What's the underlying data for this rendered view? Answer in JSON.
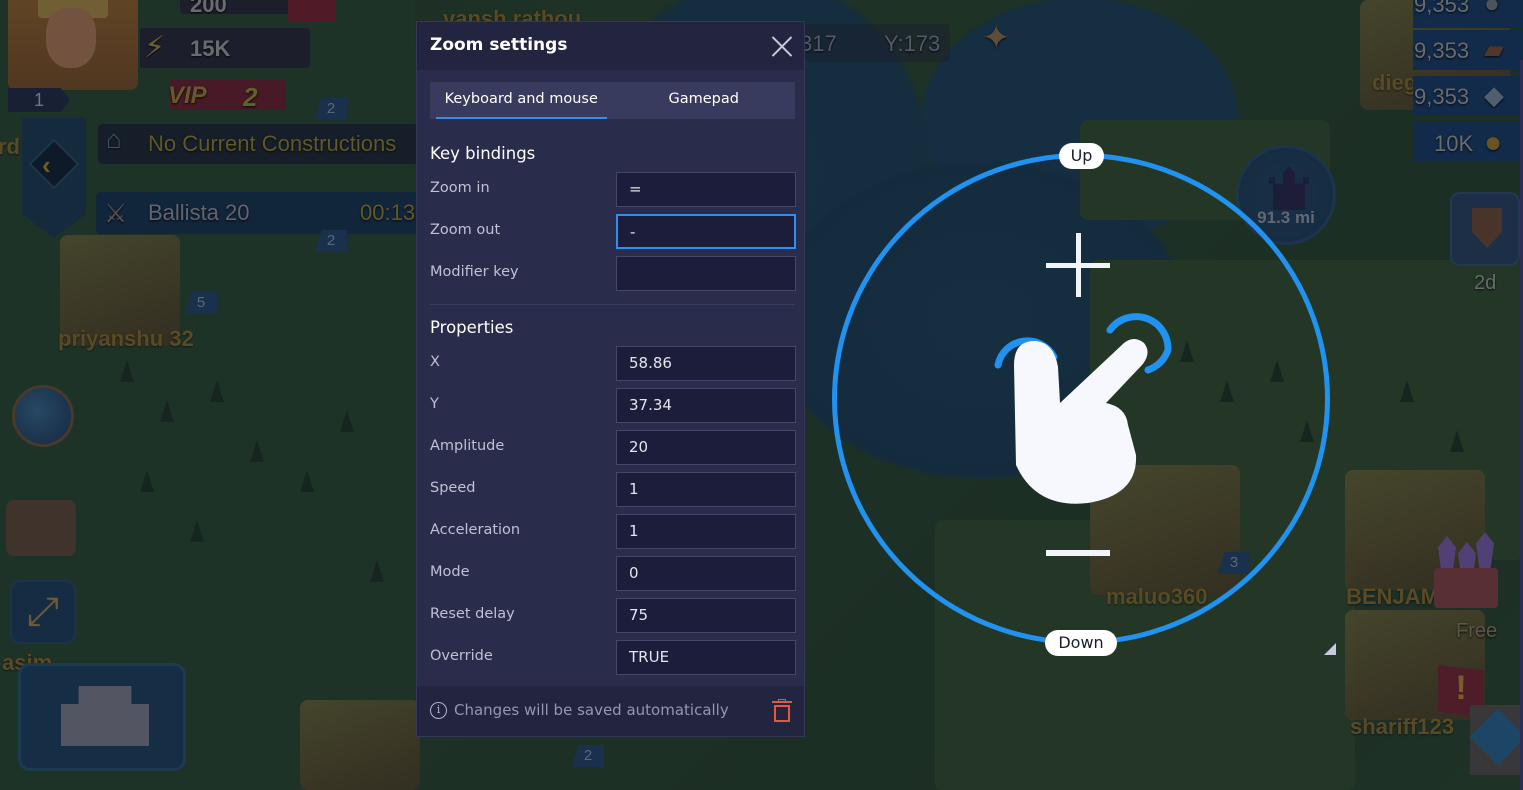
{
  "game_hud": {
    "gems": "200",
    "energy": "15K",
    "vip_label": "VIP",
    "vip_level": "2",
    "player_level": "1",
    "construction_status": "No Current Constructions",
    "training_item": "Ballista 20",
    "training_timer": "00:13",
    "coord_x_partial": "317",
    "coord_y": "Y:173",
    "resources": [
      "9,353",
      "9,353",
      "9,353",
      "10K"
    ],
    "distance": "91.3 mi",
    "guild_timer": "2d",
    "chest_label": "Free",
    "flag_numbers": [
      "2",
      "2",
      "5",
      "3",
      "2"
    ],
    "player_names": [
      "vansh rathou",
      "priyanshu 32",
      "maluo360",
      "BENJAM",
      "shariff123",
      "dieg",
      "asim",
      "rd"
    ]
  },
  "dialog": {
    "title": "Zoom settings",
    "close_icon": "close-icon",
    "tabs": [
      {
        "label": "Keyboard and mouse",
        "active": true
      },
      {
        "label": "Gamepad",
        "active": false
      }
    ],
    "key_bindings": {
      "title": "Key bindings",
      "fields": [
        {
          "label": "Zoom in",
          "value": "="
        },
        {
          "label": "Zoom out",
          "value": "-"
        },
        {
          "label": "Modifier key",
          "value": ""
        }
      ]
    },
    "properties": {
      "title": "Properties",
      "fields": [
        {
          "label": "X",
          "value": "58.86"
        },
        {
          "label": "Y",
          "value": "37.34"
        },
        {
          "label": "Amplitude",
          "value": "20"
        },
        {
          "label": "Speed",
          "value": "1"
        },
        {
          "label": "Acceleration",
          "value": "1"
        },
        {
          "label": "Mode",
          "value": "0"
        },
        {
          "label": "Reset delay",
          "value": "75"
        },
        {
          "label": "Override",
          "value": "TRUE"
        }
      ]
    },
    "footer_note": "Changes will be saved automatically",
    "info_glyph": "i"
  },
  "zoom_widget": {
    "up_label": "Up",
    "down_label": "Down",
    "ring_color": "#2192f0"
  },
  "colors": {
    "accent": "#2f8ff0",
    "dialog_bg": "#2a2c4b",
    "input_bg": "#1b1d3a",
    "delete": "#e05a3e"
  }
}
